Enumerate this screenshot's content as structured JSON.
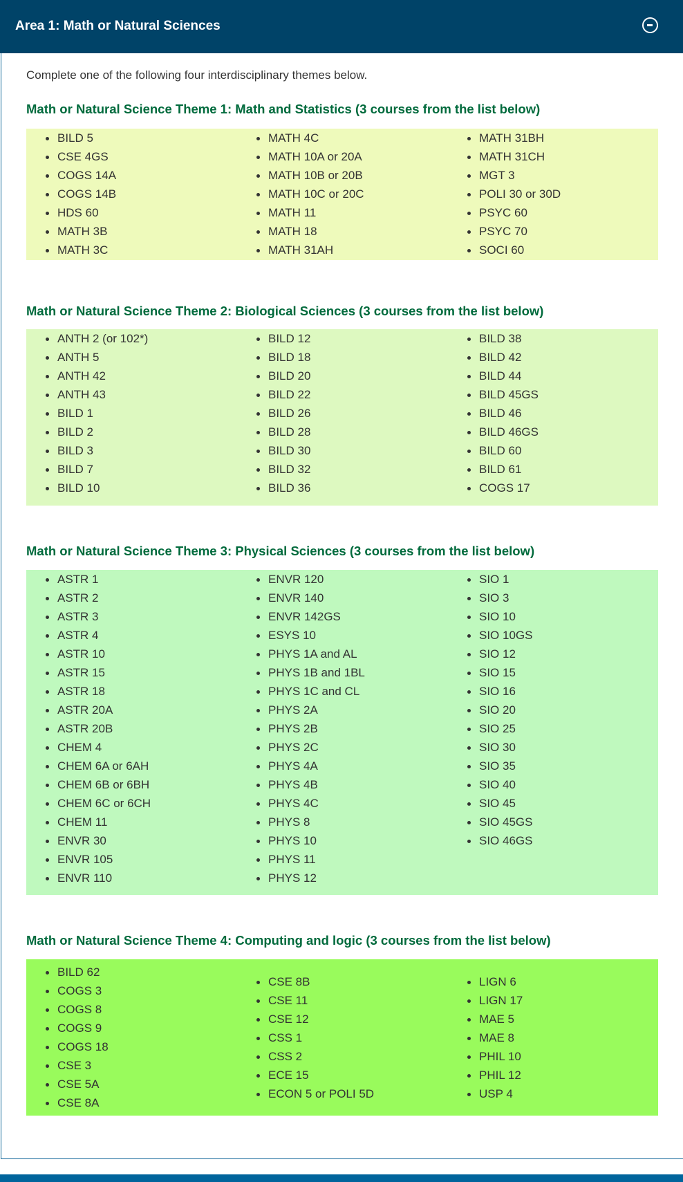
{
  "accordion": {
    "title": "Area 1: Math or Natural Sciences",
    "toggle_icon": "minus-circle-icon",
    "expanded": true
  },
  "intro": "Complete one of the following four interdisciplinary themes below.",
  "themes": [
    {
      "heading": "Math or Natural Science Theme 1: Math and Statistics (3 courses from the list below)",
      "background": "#eefabb",
      "columns": [
        [
          "BILD 5",
          "CSE 4GS",
          "COGS 14A",
          "COGS 14B",
          "HDS 60",
          "MATH 3B",
          "MATH 3C"
        ],
        [
          "MATH 4C",
          "MATH 10A or 20A",
          "MATH 10B or 20B",
          "MATH 10C or 20C",
          "MATH 11",
          "MATH 18",
          "MATH 31AH"
        ],
        [
          "MATH 31BH",
          "MATH 31CH",
          "MGT 3",
          "POLI 30 or 30D",
          "PSYC 60",
          "PSYC 70",
          "SOCI 60"
        ]
      ]
    },
    {
      "heading": "Math or Natural Science Theme 2: Biological Sciences (3 courses from the list below)",
      "background": "#ddf9c0",
      "columns": [
        [
          "ANTH 2 (or 102*)",
          "ANTH 5",
          "ANTH 42",
          "ANTH 43",
          "BILD 1",
          "BILD 2",
          "BILD 3",
          "BILD 7",
          "BILD 10"
        ],
        [
          "BILD 12",
          "BILD 18",
          "BILD 20",
          "BILD 22",
          "BILD 26",
          "BILD 28",
          "BILD 30",
          "BILD 32",
          "BILD 36"
        ],
        [
          "BILD 38",
          "BILD 42",
          "BILD 44",
          "BILD 45GS",
          "BILD 46",
          "BILD 46GS",
          "BILD 60",
          "BILD 61",
          "COGS 17"
        ]
      ]
    },
    {
      "heading": "Math or Natural Science Theme 3:  Physical Sciences (3 courses from the list below)",
      "background": "#bff9be",
      "columns": [
        [
          "ASTR 1",
          "ASTR 2",
          "ASTR 3",
          "ASTR 4",
          "ASTR 10",
          "ASTR 15",
          "ASTR 18",
          "ASTR 20A",
          "ASTR 20B",
          "CHEM 4",
          "CHEM 6A or 6AH",
          "CHEM 6B or 6BH",
          "CHEM 6C or 6CH",
          "CHEM 11",
          "ENVR 30",
          "ENVR 105",
          "ENVR 110"
        ],
        [
          "ENVR 120",
          "ENVR 140",
          "ENVR 142GS",
          "ESYS 10",
          "PHYS 1A and AL",
          "PHYS 1B and 1BL",
          "PHYS 1C and CL",
          "PHYS 2A",
          "PHYS 2B",
          "PHYS 2C",
          "PHYS 4A",
          "PHYS 4B",
          "PHYS 4C",
          "PHYS 8",
          "PHYS 10",
          "PHYS 11",
          "PHYS 12"
        ],
        [
          "SIO 1",
          "SIO 3",
          "SIO 10",
          "SIO 10GS",
          "SIO 12",
          "SIO 15",
          "SIO 16",
          "SIO 20",
          "SIO 25",
          "SIO 30",
          "SIO 35",
          "SIO 40",
          "SIO 45",
          "SIO 45GS",
          "SIO 46GS"
        ]
      ]
    },
    {
      "heading": "Math or Natural Science Theme 4: Computing and logic (3 courses from the list below)",
      "background": "#99fb5c",
      "columns": [
        [
          "BILD 62",
          "COGS 3",
          "COGS 8",
          "COGS 9",
          "COGS 18",
          "CSE 3",
          "CSE 5A",
          "CSE 8A"
        ],
        [
          "CSE 8B",
          "CSE 11",
          "CSE 12",
          "CSS 1",
          "CSS 2",
          "ECE 15",
          "ECON 5 or POLI 5D"
        ],
        [
          "LIGN 6",
          "LIGN 17",
          "MAE 5",
          "MAE 8",
          "PHIL 10",
          "PHIL 12",
          "USP 4"
        ]
      ]
    }
  ],
  "colors": {
    "header_bg": "#004368",
    "heading_green": "#006a3c",
    "panel_border": "#0a6396",
    "footer_bar": "#00649c"
  }
}
